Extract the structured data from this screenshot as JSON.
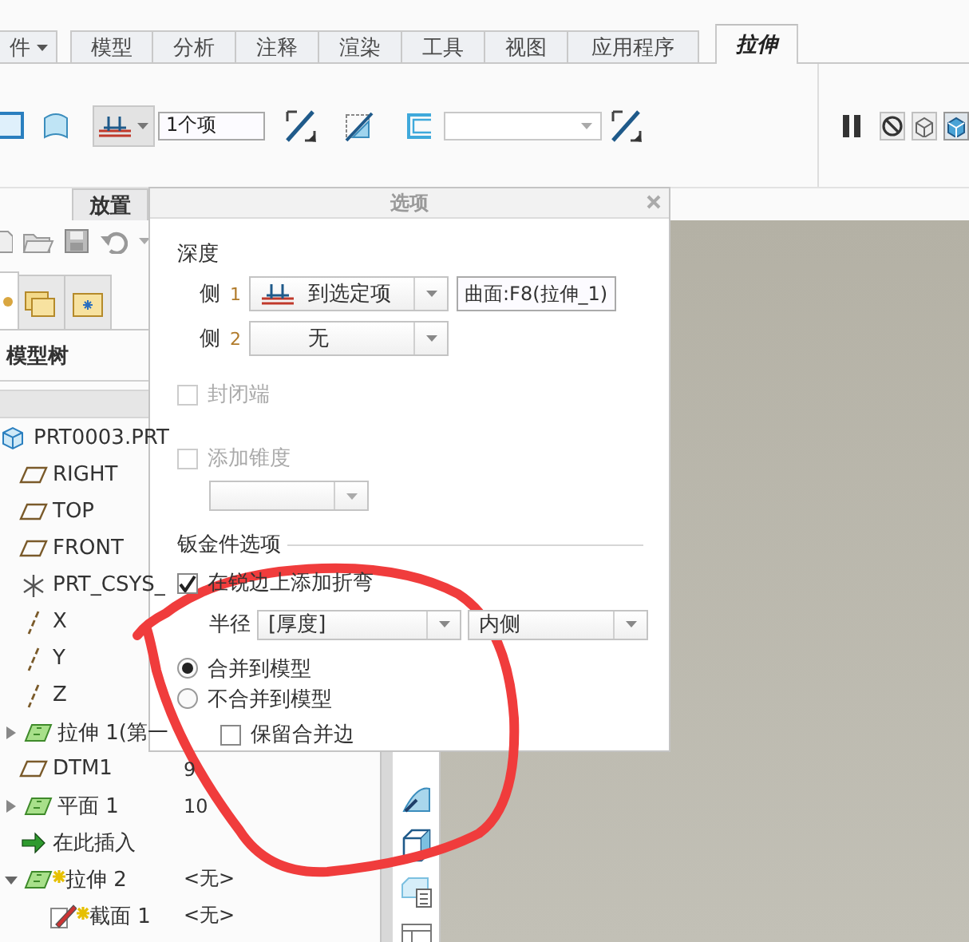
{
  "ribbon_tabs": [
    {
      "label": "件",
      "kind": "menu",
      "selected": false
    },
    {
      "label": "模型",
      "kind": "tab",
      "selected": false
    },
    {
      "label": "分析",
      "kind": "tab",
      "selected": false
    },
    {
      "label": "注释",
      "kind": "tab",
      "selected": false
    },
    {
      "label": "渲染",
      "kind": "tab",
      "selected": false
    },
    {
      "label": "工具",
      "kind": "tab",
      "selected": false
    },
    {
      "label": "视图",
      "kind": "tab",
      "selected": false
    },
    {
      "label": "应用程序",
      "kind": "tab",
      "selected": false
    },
    {
      "label": "拉伸",
      "kind": "tab",
      "selected": true
    }
  ],
  "ribbon": {
    "depth_field": "1个项",
    "sub_tabs": [
      {
        "label": "放置",
        "selected": false
      }
    ]
  },
  "model_tree": {
    "nav_tabs": [
      {
        "selected": true
      },
      {
        "selected": false
      },
      {
        "selected": false
      }
    ],
    "title": "模型树",
    "items": [
      {
        "name": "PRT0003.PRT",
        "kind": "part",
        "children": [
          {
            "name": "RIGHT",
            "kind": "plane"
          },
          {
            "name": "TOP",
            "kind": "plane"
          },
          {
            "name": "FRONT",
            "kind": "plane"
          },
          {
            "name": "PRT_CSYS_",
            "kind": "csys"
          },
          {
            "name": "X",
            "kind": "axis"
          },
          {
            "name": "Y",
            "kind": "axis"
          },
          {
            "name": "Z",
            "kind": "axis"
          },
          {
            "name": "拉伸 1(第一",
            "kind": "extrude",
            "expanded": false
          },
          {
            "name": "DTM1",
            "kind": "plane",
            "value": "9"
          },
          {
            "name": "平面 1",
            "kind": "extrude",
            "expanded": false,
            "value": "10"
          },
          {
            "name": "在此插入",
            "kind": "insert"
          },
          {
            "name": "拉伸 2",
            "kind": "extrude",
            "expanded": true,
            "new": true,
            "value": "<无>",
            "children": [
              {
                "name": "截面 1",
                "kind": "sketch",
                "new": true,
                "value": "<无>"
              }
            ]
          }
        ]
      }
    ]
  },
  "options_dialog": {
    "title": "选项",
    "depth_label": "深度",
    "sides": [
      {
        "label": "侧",
        "number": "1",
        "kind": "to_selected",
        "value": "到选定项",
        "reference": "曲面:F8(拉伸_1)"
      },
      {
        "label": "侧",
        "number": "2",
        "kind": "plain",
        "value": "无"
      }
    ],
    "capped_ends": {
      "label": "封闭端",
      "checked": false,
      "disabled": true
    },
    "add_taper": {
      "label": "添加锥度",
      "checked": false,
      "disabled": true
    },
    "sheetmetal": {
      "title": "钣金件选项",
      "add_bends": {
        "label": "在锐边上添加折弯",
        "checked": true
      },
      "radius_label": "半径",
      "radius_value": "[厚度]",
      "side_value": "内侧",
      "merge_options": [
        {
          "label": "合并到模型",
          "selected": true
        },
        {
          "label": "不合并到模型",
          "selected": false
        }
      ],
      "keep_edges": {
        "label": "保留合并边",
        "checked": false
      }
    }
  }
}
